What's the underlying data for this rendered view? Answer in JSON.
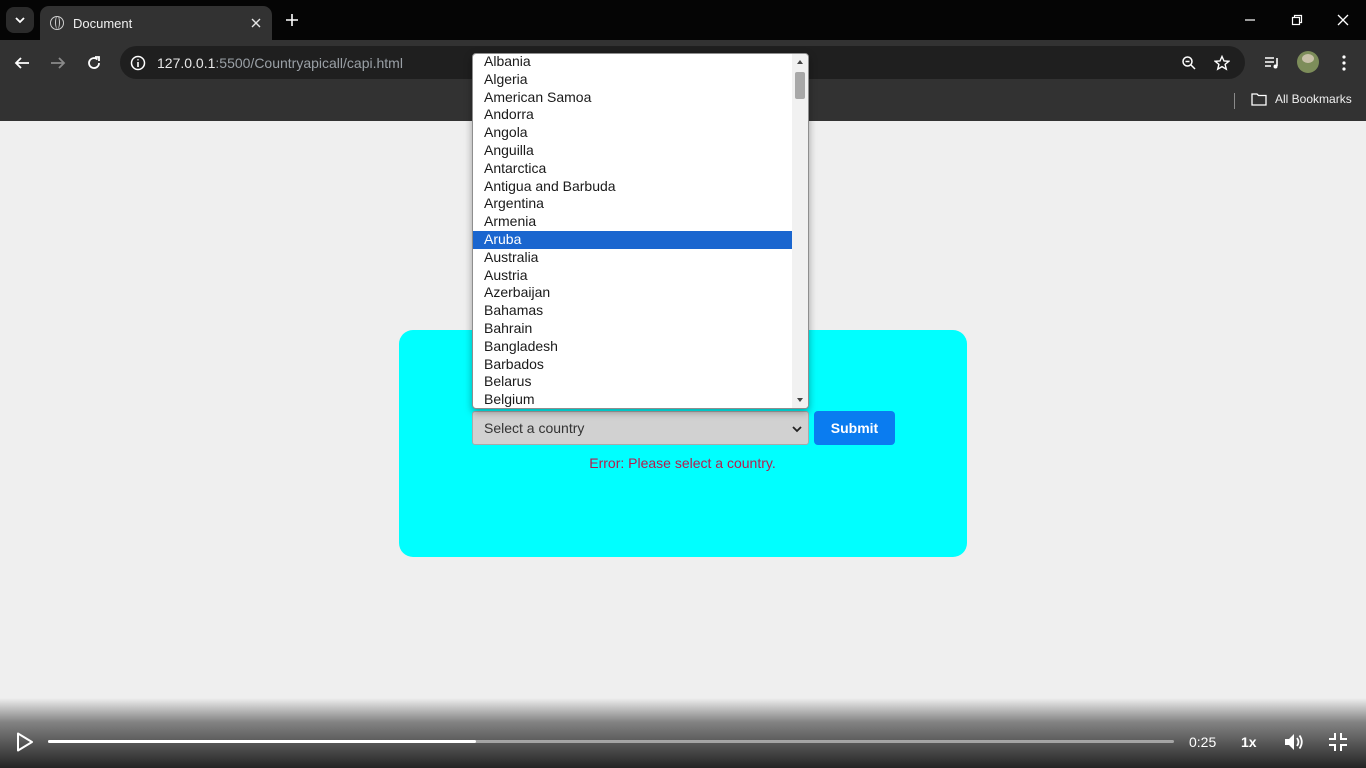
{
  "browser": {
    "tab": {
      "title": "Document",
      "favicon": "globe-icon"
    },
    "address": {
      "host": "127.0.0.1",
      "path": ":5500/Countryapicall/capi.html"
    },
    "bookmarks": {
      "all_label": "All Bookmarks"
    }
  },
  "page": {
    "select": {
      "placeholder": "Select a country",
      "options": [
        "Albania",
        "Algeria",
        "American Samoa",
        "Andorra",
        "Angola",
        "Anguilla",
        "Antarctica",
        "Antigua and Barbuda",
        "Argentina",
        "Armenia",
        "Aruba",
        "Australia",
        "Austria",
        "Azerbaijan",
        "Bahamas",
        "Bahrain",
        "Bangladesh",
        "Barbados",
        "Belarus",
        "Belgium"
      ],
      "highlighted": "Aruba"
    },
    "submit_label": "Submit",
    "error": "Error: Please select a country."
  },
  "video": {
    "time": "0:25",
    "speed": "1x",
    "progress": 0.38
  },
  "colors": {
    "card": "#00ffff",
    "submit": "#0a7cf0",
    "error": "#b71c4c",
    "highlight": "#1a66cf"
  }
}
